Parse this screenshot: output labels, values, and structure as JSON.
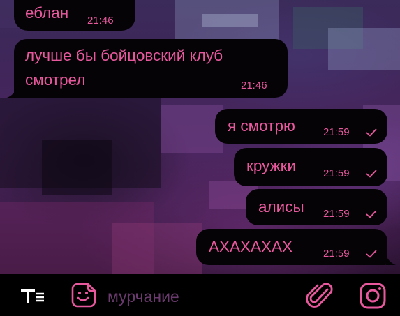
{
  "theme": {
    "bubble_bg": "#050306",
    "text_color": "#e7589d",
    "icon_color": "#e7589d",
    "placeholder_color": "#6a3a6e"
  },
  "messages": [
    {
      "direction": "incoming",
      "lines": [
        "еблан"
      ],
      "time": "21:46",
      "read": false
    },
    {
      "direction": "incoming",
      "lines": [
        "лучше бы бойцовский клуб",
        "смотрел"
      ],
      "time": "21:46",
      "read": false
    },
    {
      "direction": "outgoing",
      "lines": [
        "я смотрю"
      ],
      "time": "21:59",
      "read": true
    },
    {
      "direction": "outgoing",
      "lines": [
        "кружки"
      ],
      "time": "21:59",
      "read": true
    },
    {
      "direction": "outgoing",
      "lines": [
        "алисы"
      ],
      "time": "21:59",
      "read": true
    },
    {
      "direction": "outgoing",
      "lines": [
        "АХАХАХАХ"
      ],
      "time": "21:59",
      "read": true
    }
  ],
  "composer": {
    "placeholder": "мурчание",
    "icons": [
      "text-format-icon",
      "sticker-icon",
      "paperclip-icon",
      "instagram-camera-icon"
    ]
  }
}
